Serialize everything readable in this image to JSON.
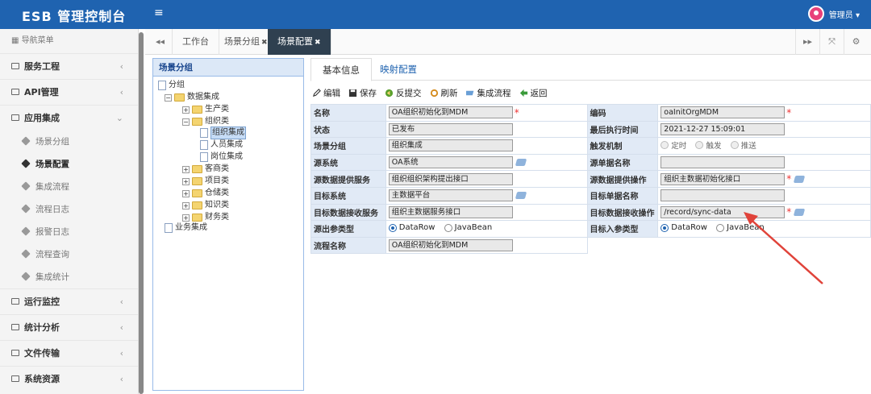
{
  "header": {
    "title": "ESB 管理控制台",
    "menu_toggle": "≡",
    "user": "管理员 ▾",
    "bar_color": "#1f63b0"
  },
  "sidebar": {
    "nav_title": "导航菜单",
    "menus": [
      {
        "label": "服务工程",
        "chev": "‹"
      },
      {
        "label": "API管理",
        "chev": "‹"
      },
      {
        "label": "应用集成",
        "chev": "⌄"
      }
    ],
    "subs": [
      "场景分组",
      "场景配置",
      "集成流程",
      "流程日志",
      "报警日志",
      "流程查询",
      "集成统计"
    ],
    "menus2": [
      {
        "label": "运行监控",
        "chev": "‹"
      },
      {
        "label": "统计分析",
        "chev": "‹"
      },
      {
        "label": "文件传输",
        "chev": "‹"
      },
      {
        "label": "系统资源",
        "chev": "‹"
      }
    ]
  },
  "page_tabs": {
    "back": "◂◂",
    "items": [
      "工作台",
      "场景分组",
      "场景配置"
    ],
    "close": "✖",
    "fwd": "▸▸",
    "expand": "⤧",
    "gear": "⚙"
  },
  "tree": {
    "title": "场景分组",
    "nodes": [
      "分组",
      "数据集成",
      "生产类",
      "组织类",
      "组织集成",
      "人员集成",
      "岗位集成",
      "客商类",
      "项目类",
      "仓储类",
      "知识类",
      "财务类",
      "业务集成"
    ],
    "plus": "+",
    "minus": "−"
  },
  "form_tabs": [
    "基本信息",
    "映射配置"
  ],
  "toolbar": [
    "编辑",
    "保存",
    "反提交",
    "刷新",
    "集成流程",
    "返回"
  ],
  "form": {
    "rows": [
      {
        "l1": "名称",
        "v1": "OA组织初始化到MDM",
        "r1": "*",
        "l2": "编码",
        "v2": "oaInitOrgMDM",
        "r2": "*"
      },
      {
        "l1": "状态",
        "v1": "已发布",
        "l2": "最后执行时间",
        "v2": "2021-12-27 15:09:01"
      },
      {
        "l1": "场景分组",
        "v1": "组织集成",
        "l2": "触发机制",
        "radios": [
          "定时",
          "触发",
          "推送"
        ]
      },
      {
        "l1": "源系统",
        "v1": "OA系统",
        "l2": "源单据名称",
        "v2": ""
      },
      {
        "l1": "源数据提供服务",
        "v1": "组织组织架构提出接口",
        "l2": "源数据提供操作",
        "v2": "组织主数据初始化接口",
        "r2": "*"
      },
      {
        "l1": "目标系统",
        "v1": "主数据平台",
        "l2": "目标单据名称",
        "v2": ""
      },
      {
        "l1": "目标数据接收服务",
        "v1": "组织主数据服务接口",
        "l2": "目标数据接收操作",
        "v2": "/record/sync-data",
        "r2": "*"
      },
      {
        "l1": "源出参类型",
        "o1": [
          "DataRow",
          "JavaBean"
        ],
        "l2": "目标入参类型",
        "o2": [
          "DataRow",
          "JavaBean"
        ]
      },
      {
        "l1": "流程名称",
        "v1": "OA组织初始化到MDM"
      }
    ]
  },
  "colors": {
    "arrow": "#e0433a",
    "label_bg": "#e1eaf6",
    "active_tab": "#2f4050"
  }
}
